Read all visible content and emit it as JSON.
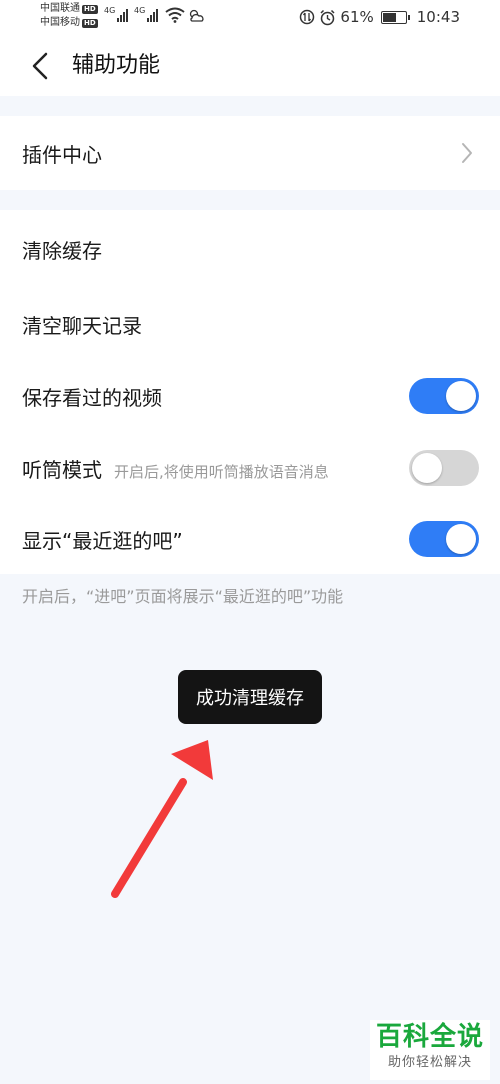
{
  "status_bar": {
    "carrier1": "中国联通",
    "carrier2": "中国移动",
    "hd": "HD",
    "net1": "4G",
    "net2": "4G",
    "battery_percent": "61%",
    "battery_level": 0.61,
    "time": "10:43"
  },
  "header": {
    "title": "辅助功能"
  },
  "settings": {
    "plugin_center": "插件中心",
    "clear_cache": "清除缓存",
    "clear_chat": "清空聊天记录",
    "save_videos": {
      "label": "保存看过的视频",
      "on": true
    },
    "earpiece_mode": {
      "label": "听筒模式",
      "hint": "开启后,将使用听筒播放语音消息",
      "on": false
    },
    "show_recent": {
      "label": "显示“最近逛的吧”",
      "on": true
    },
    "footnote": "开启后，“进吧”页面将展示“最近逛的吧”功能"
  },
  "toast": "成功清理缓存",
  "watermark": {
    "title": "百科全说",
    "subtitle": "助你轻松解决"
  },
  "colors": {
    "toggle_on": "#2f7df6",
    "toggle_off": "#d6d6d6",
    "annotation_arrow": "#f23a3a",
    "watermark_green": "#1aa83c"
  }
}
